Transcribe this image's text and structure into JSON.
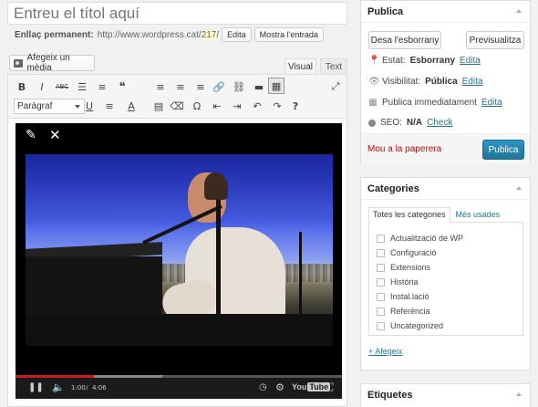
{
  "editor": {
    "title_placeholder": "Entreu el títol aquí",
    "permalink_label": "Enllaç permanent:",
    "permalink_base": "http://www.wordpress.cat/",
    "permalink_id": "217",
    "permalink_slash": "/",
    "edit_permalink_label": "Edita",
    "view_post_label": "Mostra l'entrada",
    "add_media_label": "Afegeix un mèdia",
    "tab_visual": "Visual",
    "tab_text": "Text",
    "format_select_value": "Paràgraf",
    "toolbar_row1": [
      "B",
      "I",
      "ABC",
      "☰",
      "≡",
      "❝",
      "≡",
      "≡",
      "≡",
      "🔗",
      "⛓",
      "▬",
      "▦"
    ],
    "toolbar_row2": [
      "U",
      "≡",
      "A",
      "▤",
      "⌫",
      "Ω",
      "⇤",
      "⇥",
      "↶",
      "↷",
      "?"
    ],
    "fullscreen_icon": "⤢"
  },
  "video": {
    "current_time": "1:00",
    "duration": "4:06",
    "time_separator": " / ",
    "progress": 0.24,
    "buffered": 0.45,
    "logo_you": "You",
    "logo_tube": "Tube"
  },
  "publish": {
    "title": "Publica",
    "save_draft": "Desa l'esborrany",
    "preview": "Previsualitza",
    "status_label": "Estat:",
    "status_value": "Esborrany",
    "visibility_label": "Visibilitat:",
    "visibility_value": "Pública",
    "schedule_label": "Publica immediatament",
    "seo_label": "SEO:",
    "seo_value": "N/A",
    "seo_link": "Check",
    "edit_link": "Edita",
    "trash_label": "Mou a la paperera",
    "publish_button": "Publica"
  },
  "categories": {
    "title": "Categories",
    "tab_all": "Totes les categories",
    "tab_popular": "Més usades",
    "items": [
      "Actualització de WP",
      "Configuració",
      "Extensions",
      "Història",
      "Instal.lació",
      "Referència",
      "Uncategorized"
    ],
    "add_link": "+ Afegeix"
  },
  "tags": {
    "title": "Etiquetes"
  },
  "colors": {
    "accent": "#21759b",
    "publish_button": "#2a95c5",
    "trash": "#bc0b0b",
    "video_progress": "#cc181e"
  }
}
